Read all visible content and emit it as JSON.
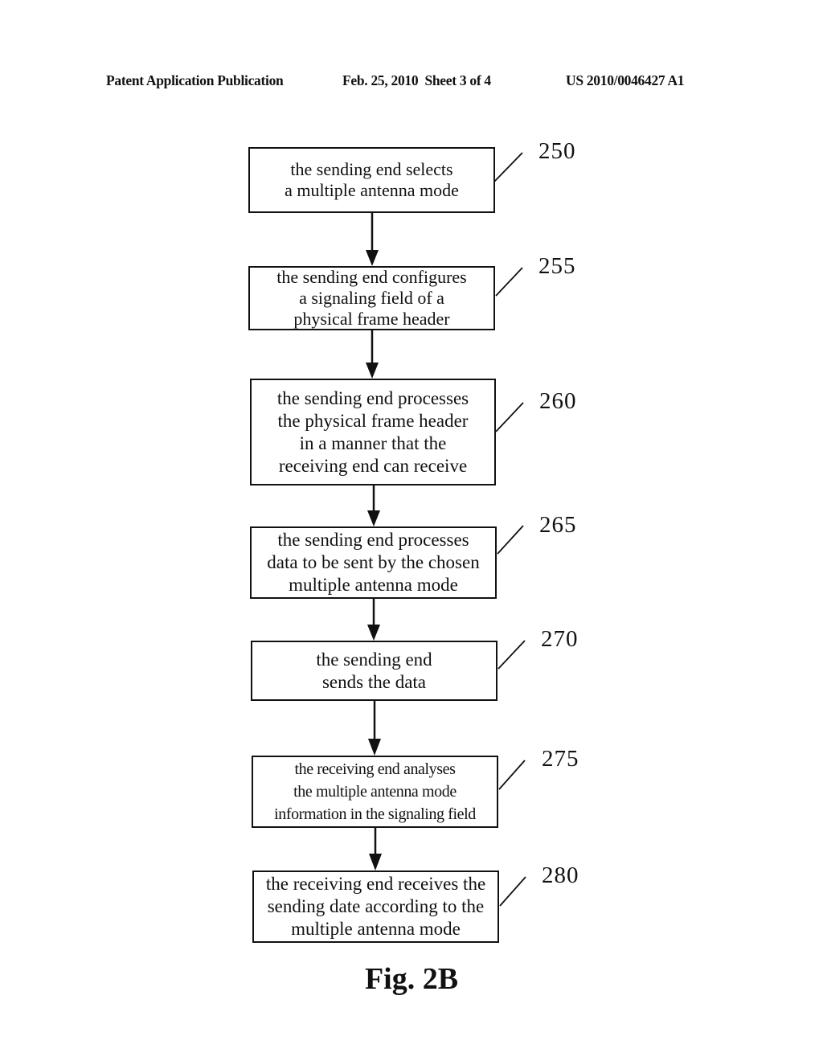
{
  "header": {
    "publication": "Patent Application Publication",
    "date_sheet": "Feb. 25, 2010  Sheet 3 of 4",
    "number": "US 2010/0046427 A1"
  },
  "steps": [
    {
      "ref": "250",
      "text": "the sending end selects\na multiple antenna mode"
    },
    {
      "ref": "255",
      "text": "the sending end configures\na signaling field of a\nphysical frame header"
    },
    {
      "ref": "260",
      "text": "the sending end processes\nthe physical frame header\nin a manner that the\nreceiving end can receive"
    },
    {
      "ref": "265",
      "text": "the sending end processes\ndata to be sent by the chosen\nmultiple antenna mode"
    },
    {
      "ref": "270",
      "text": "the sending end\nsends the data"
    },
    {
      "ref": "275",
      "text": "the receiving end analyses\nthe multiple antenna mode\ninformation in the signaling field"
    },
    {
      "ref": "280",
      "text": "the receiving end receives the\nsending date according to the\nmultiple antenna mode"
    }
  ],
  "figure_label": "Fig. 2B"
}
